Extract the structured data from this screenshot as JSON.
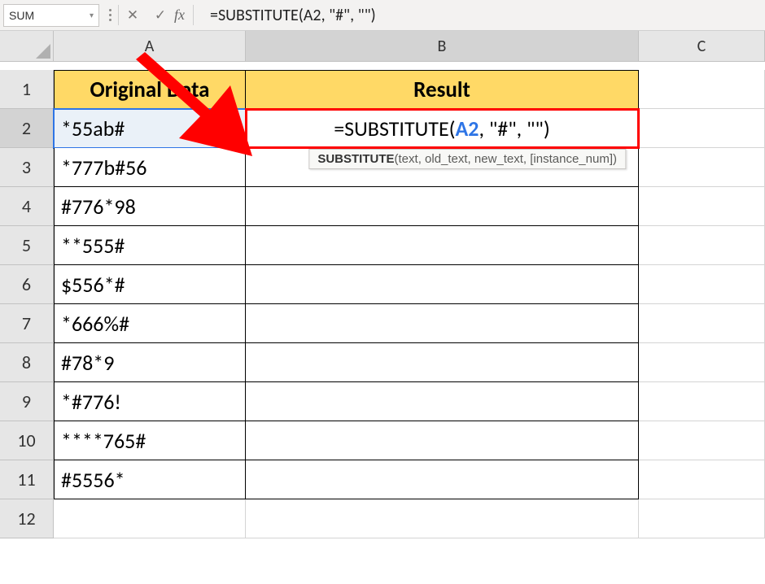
{
  "formula_bar": {
    "name_box": "SUM",
    "cancel_icon": "✕",
    "enter_icon": "✓",
    "fx_label": "fx",
    "formula": "=SUBSTITUTE(A2, \"#\", \"\")"
  },
  "columns": [
    "A",
    "B",
    "C"
  ],
  "rows": [
    "1",
    "2",
    "3",
    "4",
    "5",
    "6",
    "7",
    "8",
    "9",
    "10",
    "11",
    "12"
  ],
  "headers": {
    "A": "Original Data",
    "B": "Result"
  },
  "data": {
    "A2": "*55ab#",
    "A3": "*777b#56",
    "A4": "#776*98",
    "A5": "**555#",
    "A6": "$556*#",
    "A7": "*666%#",
    "A8": "#78*9",
    "A9": "*#776!",
    "A10": "****765#",
    "A11": "#5556*"
  },
  "editing_cell": {
    "prefix": "=SUBSTITUTE(",
    "ref": "A2",
    "suffix": ", \"#\", \"\")"
  },
  "tooltip": {
    "fn": "SUBSTITUTE",
    "args": "(text, old_text, new_text, [instance_num])"
  },
  "colors": {
    "header_fill": "#ffd966",
    "ref_blue": "#2e75e6",
    "highlight_red": "#ff0000",
    "arrow_red": "#ff0000"
  }
}
